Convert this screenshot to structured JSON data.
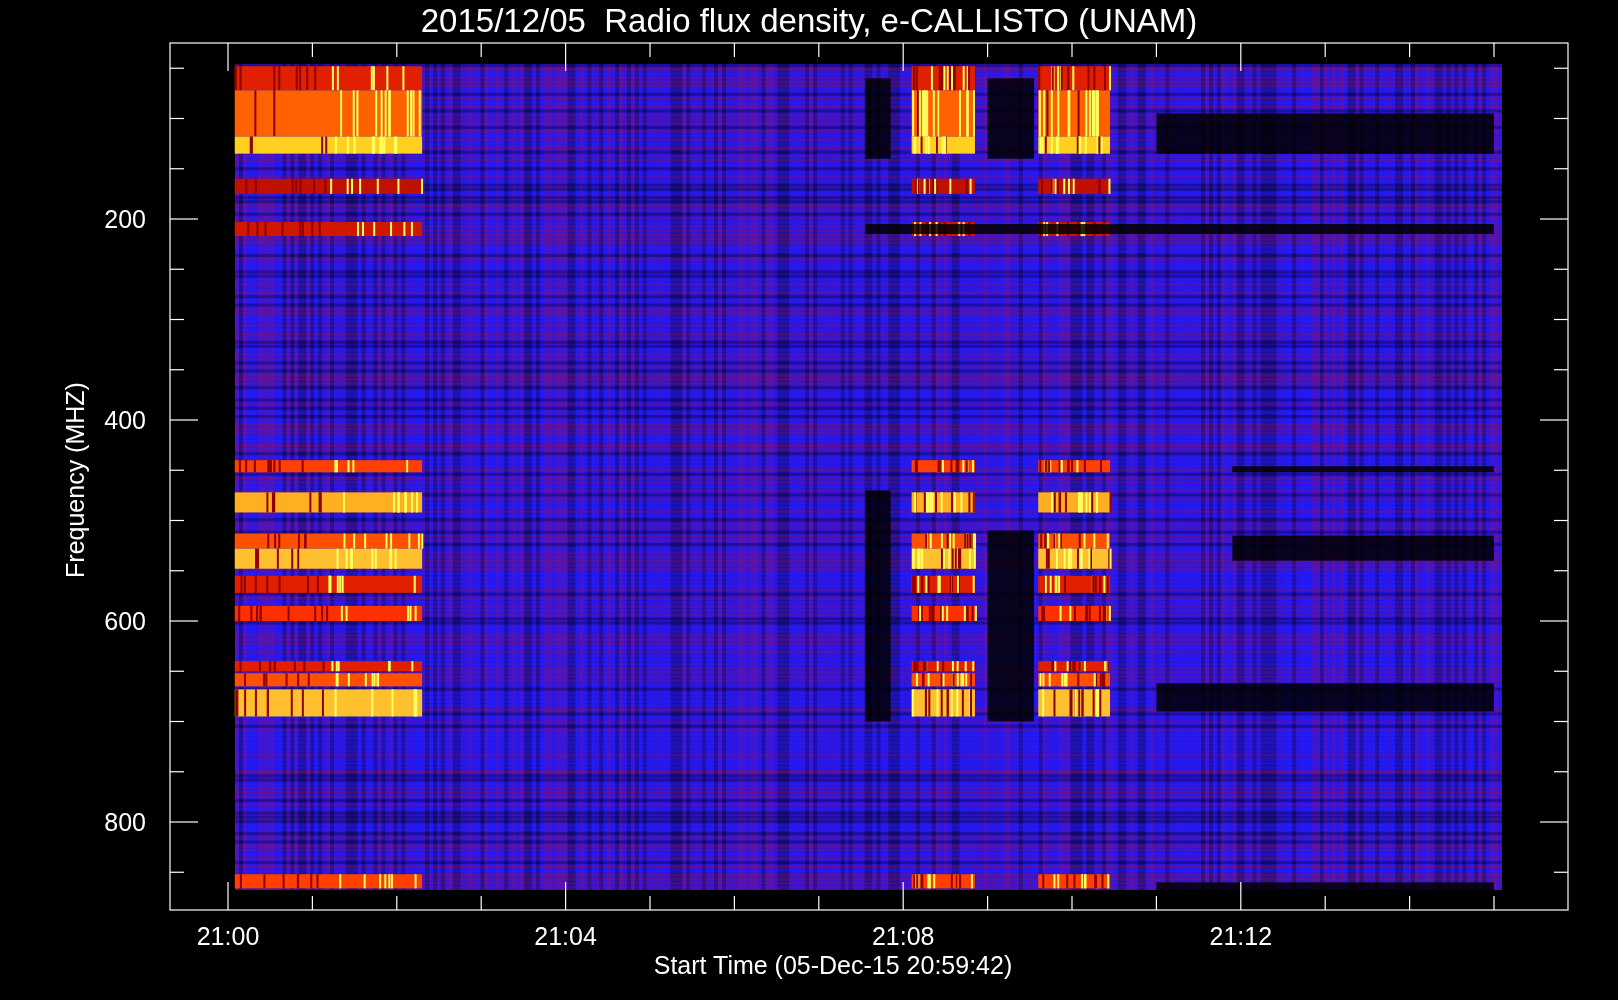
{
  "title": "2015/12/05  Radio flux density, e-CALLISTO (UNAM)",
  "chart": {
    "xlabel": "Start Time (05-Dec-15 20:59:42)",
    "ylabel": "Frequency (MHZ)",
    "xticks": [
      "21:00",
      "21:04",
      "21:08",
      "21:12"
    ],
    "yticks": [
      "200",
      "400",
      "600",
      "800"
    ]
  }
}
